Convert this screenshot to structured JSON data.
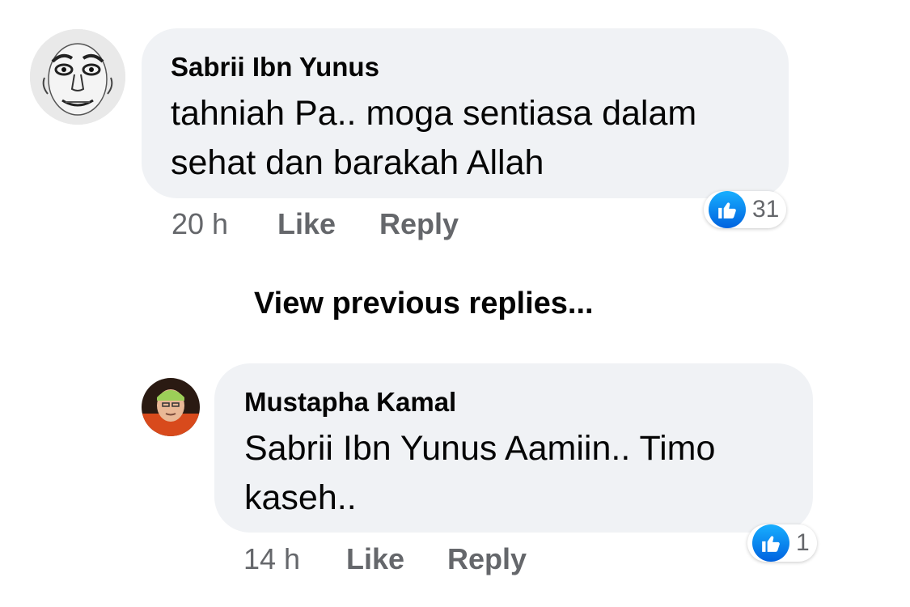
{
  "comments": [
    {
      "author": "Sabrii Ibn Yunus",
      "text_line1": "tahniah Pa.. moga sentiasa dalam",
      "text_line2": "sehat dan barakah Allah",
      "time": "20 h",
      "like_label": "Like",
      "reply_label": "Reply",
      "reaction_count": "31",
      "reaction_icon": "thumbs-up-icon"
    },
    {
      "author": "Mustapha Kamal",
      "text_line1": "Sabrii Ibn Yunus Aamiin..  Timo",
      "text_line2": "kaseh..",
      "time": "14 h",
      "like_label": "Like",
      "reply_label": "Reply",
      "reaction_count": "1",
      "reaction_icon": "thumbs-up-icon"
    }
  ],
  "view_previous_replies": "View previous replies...",
  "colors": {
    "bubble": "#f0f2f5",
    "text": "#050505",
    "secondary_text": "#65676b",
    "like_blue": "#1877f2"
  }
}
